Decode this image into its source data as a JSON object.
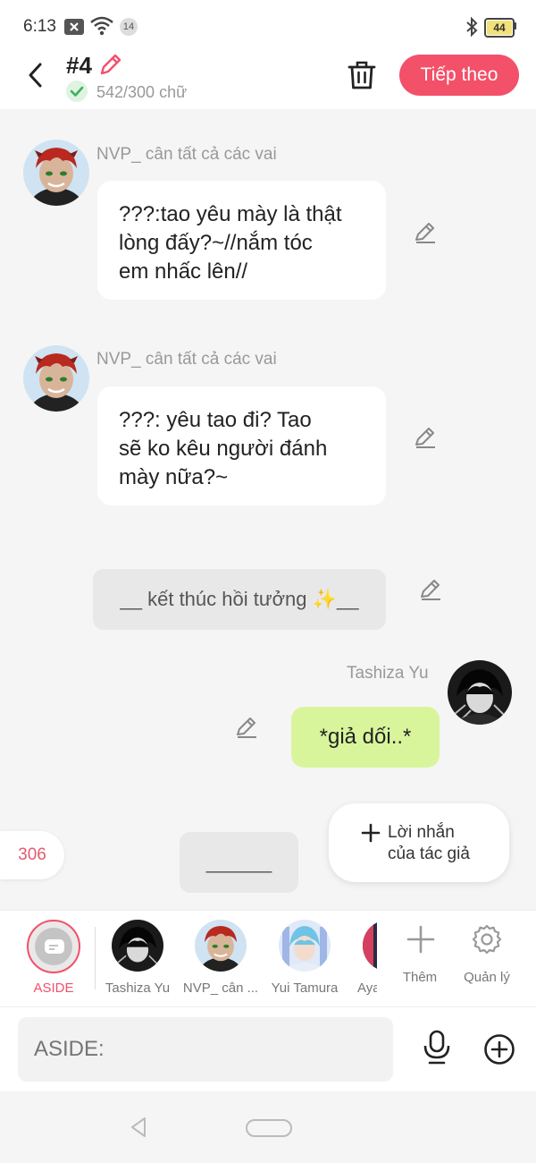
{
  "status": {
    "time": "6:13",
    "notification_count": "14",
    "battery": "44"
  },
  "header": {
    "title": "#4",
    "word_count": "542/300 chữ",
    "next_label": "Tiếp theo"
  },
  "messages": [
    {
      "speaker": "NVP_ cân tất cả các vai",
      "text_lines": [
        "???:tao yêu mày là thật",
        "lòng đấy?~//nắm tóc",
        "em nhấc lên//"
      ]
    },
    {
      "speaker": "NVP_ cân tất cả các vai",
      "text_lines": [
        "???: yêu tao đi? Tao",
        "sẽ ko kêu người đánh",
        "mày nữa?~"
      ]
    },
    {
      "narration": "__ kết thúc hồi tưởng ✨__"
    },
    {
      "speaker": "Tashiza Yu",
      "text": "*giả dối..*"
    }
  ],
  "draft": {
    "count": "306",
    "placeholder_text": "______",
    "author_note_line1": "Lời nhắn",
    "author_note_line2": "của tác giả"
  },
  "characters": [
    {
      "label": "ASIDE",
      "active": true
    },
    {
      "label": "Tashiza Yu"
    },
    {
      "label": "NVP_ cân ..."
    },
    {
      "label": "Yui Tamura"
    },
    {
      "label": "Aya"
    }
  ],
  "tools": {
    "add_label": "Thêm",
    "manage_label": "Quản lý"
  },
  "input": {
    "placeholder": "ASIDE:"
  },
  "colors": {
    "accent": "#f3506a",
    "player_bubble": "#d9f59c",
    "background": "#f5f5f5"
  }
}
